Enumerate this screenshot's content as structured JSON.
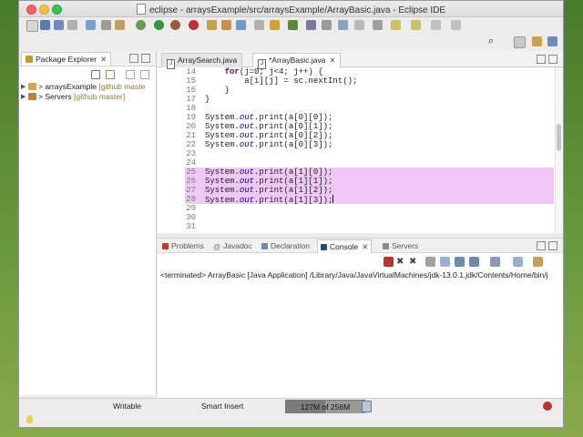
{
  "window": {
    "title": "eclipse - arraysExample/src/arraysExample/ArrayBasic.java - Eclipse IDE"
  },
  "package_explorer": {
    "tab_label": "Package Explorer",
    "close_glyph": "✕",
    "items": [
      {
        "prefix": "> ",
        "name": "arraysExample",
        "decoration": " [github maste"
      },
      {
        "prefix": "> ",
        "name": "Servers",
        "decoration": " [github master]"
      }
    ]
  },
  "editor": {
    "tabs": [
      {
        "label": "ArraySearch.java",
        "active": false
      },
      {
        "label": "*ArrayBasic.java",
        "active": true,
        "close_glyph": "✕"
      }
    ],
    "lines": [
      {
        "num": "14",
        "indent": "    ",
        "kw": "for",
        "text": "(j=0; j<4; j++) {",
        "highlight": false
      },
      {
        "num": "15",
        "indent": "        ",
        "text": "a[i][j] = sc.nextInt();",
        "highlight": false
      },
      {
        "num": "16",
        "indent": "    ",
        "text": "}",
        "highlight": false
      },
      {
        "num": "17",
        "indent": "",
        "text": "}",
        "highlight": false
      },
      {
        "num": "18",
        "indent": "",
        "text": "",
        "highlight": false
      },
      {
        "num": "19",
        "indent": "",
        "pre": "System.",
        "fld": "out",
        "text": ".print(a[0][0]);",
        "highlight": false
      },
      {
        "num": "20",
        "indent": "",
        "pre": "System.",
        "fld": "out",
        "text": ".print(a[0][1]);",
        "highlight": false
      },
      {
        "num": "21",
        "indent": "",
        "pre": "System.",
        "fld": "out",
        "text": ".print(a[0][2]);",
        "highlight": false
      },
      {
        "num": "22",
        "indent": "",
        "pre": "System.",
        "fld": "out",
        "text": ".print(a[0][3]);",
        "highlight": false
      },
      {
        "num": "23",
        "indent": "",
        "text": "",
        "highlight": false
      },
      {
        "num": "24",
        "indent": "",
        "text": "",
        "highlight": false
      },
      {
        "num": "25",
        "indent": "",
        "pre": "System.",
        "fld": "out",
        "text": ".print(a[1][0]);",
        "highlight": true
      },
      {
        "num": "26",
        "indent": "",
        "pre": "System.",
        "fld": "out",
        "text": ".print(a[1][1]);",
        "highlight": true
      },
      {
        "num": "27",
        "indent": "",
        "pre": "System.",
        "fld": "out",
        "text": ".print(a[1][2]);",
        "highlight": true
      },
      {
        "num": "28",
        "indent": "",
        "pre": "System.",
        "fld": "out",
        "text": ".print(a[1][3]);",
        "highlight": true,
        "caret": true
      },
      {
        "num": "29",
        "indent": "",
        "text": "",
        "highlight": false
      },
      {
        "num": "30",
        "indent": "",
        "text": "",
        "highlight": false
      },
      {
        "num": "31",
        "indent": "",
        "text": "",
        "highlight": false
      }
    ]
  },
  "console": {
    "tabs": [
      {
        "label": "Problems",
        "active": false,
        "icon_color": "#c0392b"
      },
      {
        "label": "Javadoc",
        "active": false,
        "icon_color": "#7a7a7a",
        "icon": "@"
      },
      {
        "label": "Declaration",
        "active": false,
        "icon_color": "#6a8ab0"
      },
      {
        "label": "Console",
        "active": true,
        "icon_color": "#2a4a7a"
      },
      {
        "label": "Servers",
        "active": false,
        "icon_color": "#8a8a8a"
      }
    ],
    "close_glyph": "✕",
    "output": "<terminated> ArrayBasic [Java Application] /Library/Java/JavaVirtualMachines/jdk-13.0.1.jdk/Contents/Home/bin/j"
  },
  "status": {
    "writable": "Writable",
    "insert_mode": "Smart Insert",
    "heap_text": "127M of 256M",
    "heap_used_fraction": 0.5
  },
  "colors": {
    "highlight": "#f0c8f5",
    "keyword": "#7f0055",
    "field": "#0000c0"
  }
}
